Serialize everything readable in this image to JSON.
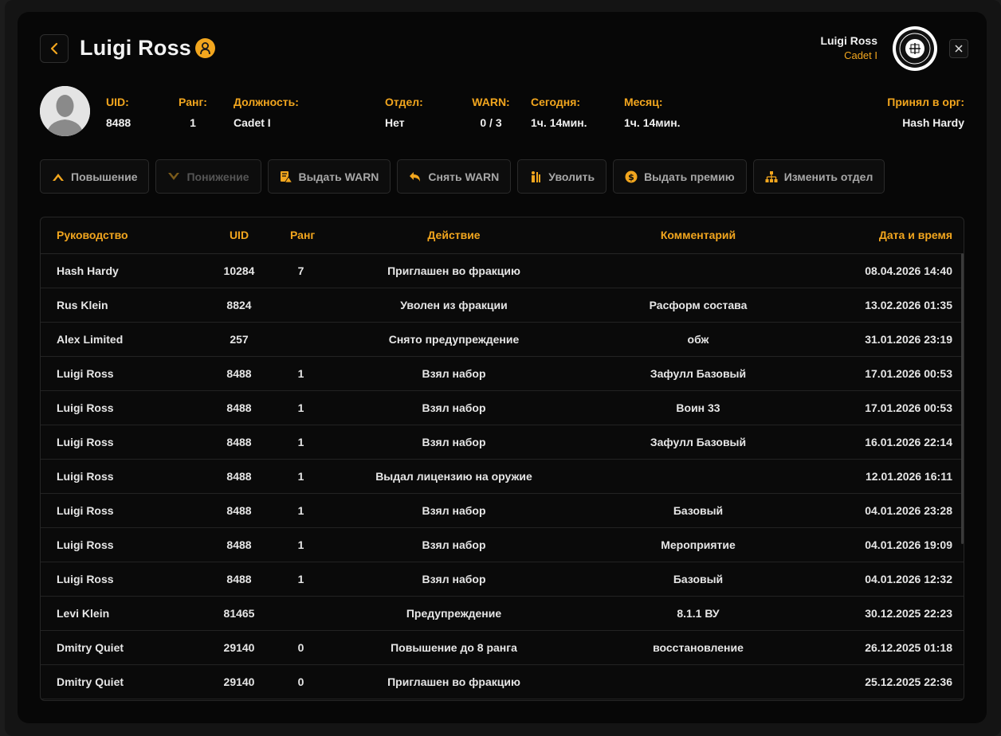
{
  "header": {
    "title": "Luigi Ross",
    "current_user_name": "Luigi Ross",
    "current_user_rank": "Cadet I"
  },
  "profile": {
    "uid_label": "UID:",
    "uid": "8488",
    "rank_label": "Ранг:",
    "rank": "1",
    "position_label": "Должность:",
    "position": "Cadet I",
    "department_label": "Отдел:",
    "department": "Нет",
    "warn_label": "WARN:",
    "warn": "0 / 3",
    "today_label": "Сегодня:",
    "today": "1ч. 14мин.",
    "month_label": "Месяц:",
    "month": "1ч. 14мин.",
    "hired_by_label": "Принял в орг:",
    "hired_by": "Hash Hardy"
  },
  "actions": [
    {
      "label": "Повышение",
      "icon": "chevron-up-icon"
    },
    {
      "label": "Понижение",
      "icon": "chevron-down-icon"
    },
    {
      "label": "Выдать WARN",
      "icon": "warning-document-icon"
    },
    {
      "label": "Снять WARN",
      "icon": "undo-arrow-icon"
    },
    {
      "label": "Уволить",
      "icon": "dismiss-person-icon"
    },
    {
      "label": "Выдать премию",
      "icon": "dollar-coin-icon"
    },
    {
      "label": "Изменить отдел",
      "icon": "org-structure-icon"
    }
  ],
  "table": {
    "headers": [
      "Руководство",
      "UID",
      "Ранг",
      "Действие",
      "Комментарий",
      "Дата и время"
    ],
    "rows": [
      [
        "Hash Hardy",
        "10284",
        "7",
        "Приглашен во фракцию",
        "",
        "08.04.2026 14:40"
      ],
      [
        "Rus Klein",
        "8824",
        "",
        "Уволен из фракции",
        "Расформ состава",
        "13.02.2026 01:35"
      ],
      [
        "Alex Limited",
        "257",
        "",
        "Снято предупреждение",
        "обж",
        "31.01.2026 23:19"
      ],
      [
        "Luigi Ross",
        "8488",
        "1",
        "Взял набор",
        "Зафулл Базовый",
        "17.01.2026 00:53"
      ],
      [
        "Luigi Ross",
        "8488",
        "1",
        "Взял набор",
        "Воин 33",
        "17.01.2026 00:53"
      ],
      [
        "Luigi Ross",
        "8488",
        "1",
        "Взял набор",
        "Зафулл Базовый",
        "16.01.2026 22:14"
      ],
      [
        "Luigi Ross",
        "8488",
        "1",
        "Выдал лицензию на оружие",
        "",
        "12.01.2026 16:11"
      ],
      [
        "Luigi Ross",
        "8488",
        "1",
        "Взял набор",
        "Базовый",
        "04.01.2026 23:28"
      ],
      [
        "Luigi Ross",
        "8488",
        "1",
        "Взял набор",
        "Мероприятие",
        "04.01.2026 19:09"
      ],
      [
        "Luigi Ross",
        "8488",
        "1",
        "Взял набор",
        "Базовый",
        "04.01.2026 12:32"
      ],
      [
        "Levi Klein",
        "81465",
        "",
        "Предупреждение",
        "8.1.1 ВУ",
        "30.12.2025 22:23"
      ],
      [
        "Dmitry Quiet",
        "29140",
        "0",
        "Повышение до 8 ранга",
        "восстановление",
        "26.12.2025 01:18"
      ],
      [
        "Dmitry Quiet",
        "29140",
        "0",
        "Приглашен во фракцию",
        "",
        "25.12.2025 22:36"
      ]
    ]
  },
  "colors": {
    "accent": "#f2a61e",
    "background": "#070707",
    "text": "#ededed"
  }
}
